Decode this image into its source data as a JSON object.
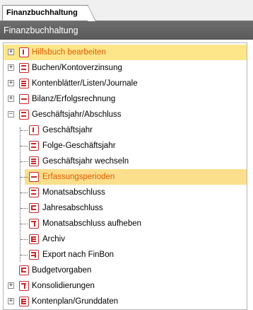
{
  "tab": {
    "label": "Finanzbuchhaltung"
  },
  "header": {
    "title": "Finanzbuchhaltung"
  },
  "tree": {
    "items": [
      {
        "label": "Hilfsbuch bearbeiten",
        "expander": "+",
        "icon": "book-icon-1"
      },
      {
        "label": "Buchen/Kontoverzinsung",
        "expander": "+",
        "icon": "book-icon-2"
      },
      {
        "label": "Kontenblätter/Listen/Journale",
        "expander": "+",
        "icon": "book-icon-3"
      },
      {
        "label": "Bilanz/Erfolgsrechnung",
        "expander": "+",
        "icon": "book-icon-4"
      },
      {
        "label": "Geschäftsjahr/Abschluss",
        "expander": "−",
        "icon": "book-icon-5"
      },
      {
        "label": "Geschäftsjahr",
        "icon": "book-icon-1"
      },
      {
        "label": "Folge-Geschäftsjahr",
        "icon": "book-icon-2"
      },
      {
        "label": "Geschäftsjahr wechseln",
        "icon": "book-icon-3"
      },
      {
        "label": "Erfassungsperioden",
        "icon": "book-icon-4"
      },
      {
        "label": "Monatsabschluss",
        "icon": "book-icon-5"
      },
      {
        "label": "Jahresabschluss",
        "icon": "book-icon-6"
      },
      {
        "label": "Monatsabschluss aufheben",
        "icon": "book-icon-7"
      },
      {
        "label": "Archiv",
        "icon": "book-icon-8"
      },
      {
        "label": "Export nach FinBon",
        "icon": "book-icon-9"
      },
      {
        "label": "Budgetvorgaben",
        "icon": "book-icon-6"
      },
      {
        "label": "Konsolidierungen",
        "expander": "+",
        "icon": "book-icon-7"
      },
      {
        "label": "Kontenplan/Grunddaten",
        "expander": "+",
        "icon": "book-icon-8"
      }
    ]
  },
  "colors": {
    "selection": "#fbdf8c",
    "accent": "#c8282c",
    "header": "#5f5f5f"
  }
}
